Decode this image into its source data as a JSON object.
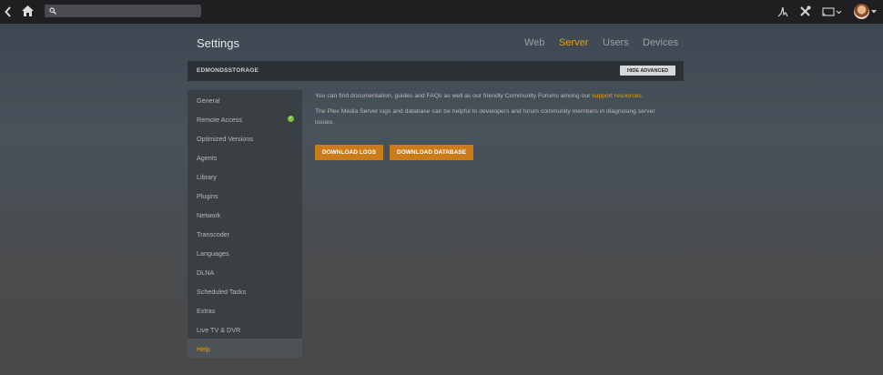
{
  "topbar": {
    "back_icon": "chevron-left-icon",
    "home_icon": "home-icon",
    "search_icon": "search-icon",
    "search_placeholder": "",
    "activity_icon": "activity-icon",
    "settings_icon": "tools-icon",
    "cast_icon": "cast-icon",
    "avatar": "user-avatar"
  },
  "page": {
    "title": "Settings",
    "tabs": [
      {
        "label": "Web",
        "active": false
      },
      {
        "label": "Server",
        "active": true
      },
      {
        "label": "Users",
        "active": false
      },
      {
        "label": "Devices",
        "active": false
      }
    ]
  },
  "server": {
    "name": "EDMONDSSTORAGE",
    "hide_advanced_label": "HIDE ADVANCED"
  },
  "sidebar": {
    "items": [
      {
        "label": "General"
      },
      {
        "label": "Remote Access",
        "status": "check"
      },
      {
        "label": "Optimized Versions"
      },
      {
        "label": "Agents"
      },
      {
        "label": "Library"
      },
      {
        "label": "Plugins"
      },
      {
        "label": "Network"
      },
      {
        "label": "Transcoder"
      },
      {
        "label": "Languages"
      },
      {
        "label": "DLNA"
      },
      {
        "label": "Scheduled Tasks"
      },
      {
        "label": "Extras"
      },
      {
        "label": "Live TV & DVR"
      },
      {
        "label": "Help",
        "active": true
      }
    ]
  },
  "help": {
    "para1_text": "You can find documentation, guides and FAQs as well as our friendly Community Forums among our ",
    "para1_link": "support resources",
    "para1_end": ".",
    "para2_text": "The Plex Media Server logs and database can be helpful to developers and forum community members in diagnosing server issues.",
    "download_logs_label": "DOWNLOAD LOGS",
    "download_db_label": "DOWNLOAD DATABASE"
  },
  "colors": {
    "accent": "#e5a00d",
    "button": "#cc7b19",
    "success": "#7ac142"
  }
}
